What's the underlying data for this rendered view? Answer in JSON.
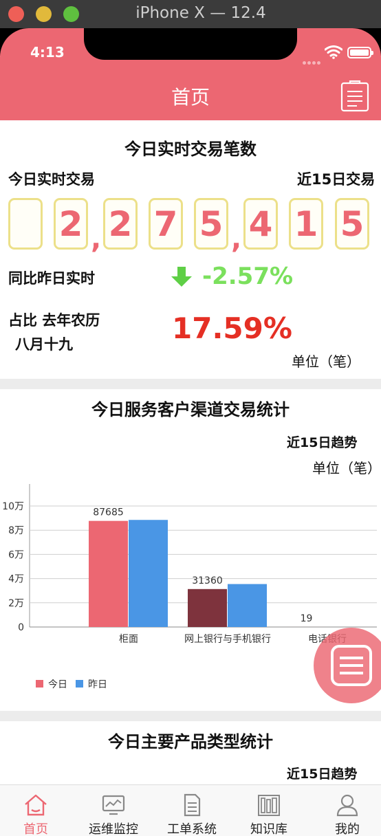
{
  "simulator": {
    "title": "iPhone X — 12.4"
  },
  "status_bar": {
    "time": "4:13"
  },
  "header": {
    "title": "首页"
  },
  "realtime": {
    "title": "今日实时交易笔数",
    "left_label": "今日实时交易",
    "right_label": "近15日交易",
    "digits": [
      "",
      "2",
      "2",
      "7",
      "5",
      "4",
      "1",
      "5"
    ],
    "separator": ",",
    "compare_label": "同比昨日实时",
    "compare_value": "-2.57%",
    "share_label_line1": "占比 去年农历",
    "share_label_line2": "八月十九",
    "share_value": "17.59%",
    "unit": "单位（笔）"
  },
  "channel": {
    "title": "今日服务客户渠道交易统计",
    "trend_link": "近15日趋势",
    "unit": "单位（笔）"
  },
  "chart_data": {
    "type": "bar",
    "categories": [
      "柜面",
      "网上银行与手机银行",
      "电话银行"
    ],
    "series": [
      {
        "name": "今日",
        "values": [
          87685,
          31360,
          19
        ],
        "color": "#ec6772"
      },
      {
        "name": "昨日",
        "values": [
          88500,
          35500,
          0
        ],
        "color": "#4a96e5"
      }
    ],
    "data_labels": [
      "87685",
      "31360",
      "19"
    ],
    "y_ticks": [
      {
        "value": 0,
        "label": "0"
      },
      {
        "value": 20000,
        "label": "2万"
      },
      {
        "value": 40000,
        "label": "4万"
      },
      {
        "value": 60000,
        "label": "6万"
      },
      {
        "value": 80000,
        "label": "8万"
      },
      {
        "value": 100000,
        "label": "10万"
      }
    ],
    "ylim": [
      0,
      100000
    ],
    "highlight_color": "#7e333d",
    "grid": true,
    "legend": "bottom-left"
  },
  "products": {
    "title": "今日主要产品类型统计",
    "trend_link": "近15日趋势"
  },
  "tabs": [
    {
      "label": "首页",
      "icon": "home-icon",
      "active": true
    },
    {
      "label": "运维监控",
      "icon": "monitor-icon",
      "active": false
    },
    {
      "label": "工单系统",
      "icon": "document-icon",
      "active": false
    },
    {
      "label": "知识库",
      "icon": "bookshelf-icon",
      "active": false
    },
    {
      "label": "我的",
      "icon": "user-icon",
      "active": false
    }
  ],
  "colors": {
    "accent": "#ec6772",
    "positive": "#7be05d",
    "negative": "#e52f24",
    "digit_border": "#ece089"
  }
}
